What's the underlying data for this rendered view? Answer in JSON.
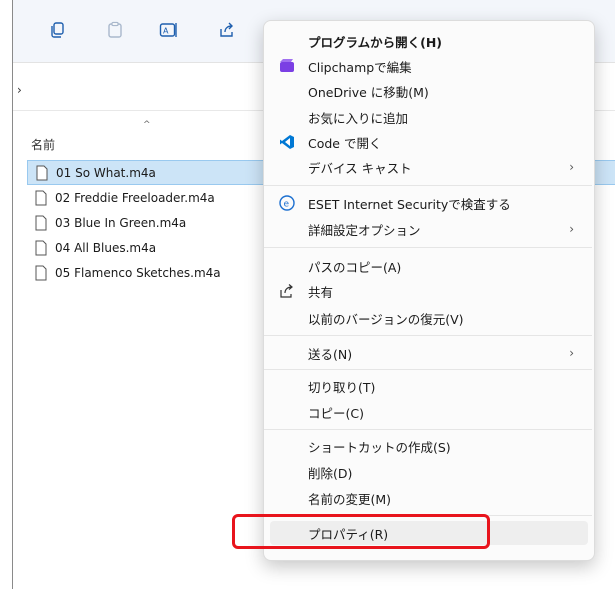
{
  "colors": {
    "selection": "#cce4f7",
    "highlight_box": "#e8141c",
    "clipchamp": "#7b3fe4",
    "vscode": "#0078d4",
    "eset": "#1b6fd0"
  },
  "toolbar": {
    "icons": [
      "copy-icon",
      "paste-icon",
      "rename-icon",
      "share-icon"
    ]
  },
  "addressbar": {
    "chevron": "›"
  },
  "column": {
    "name_header": "名前",
    "sort_caret": "^"
  },
  "files": [
    {
      "name": "01 So What.m4a"
    },
    {
      "name": "02 Freddie Freeloader.m4a"
    },
    {
      "name": "03 Blue In Green.m4a"
    },
    {
      "name": "04 All Blues.m4a"
    },
    {
      "name": "05 Flamenco Sketches.m4a"
    }
  ],
  "menu": {
    "open_with": "プログラムから開く(H)",
    "clipchamp": "Clipchampで編集",
    "onedrive": "OneDrive に移動(M)",
    "favorites": "お気に入りに追加",
    "code": "Code で開く",
    "cast": "デバイス キャスト",
    "eset": "ESET Internet Securityで検査する",
    "advanced": "詳細設定オプション",
    "copy_path": "パスのコピー(A)",
    "share": "共有",
    "restore": "以前のバージョンの復元(V)",
    "send_to": "送る(N)",
    "cut": "切り取り(T)",
    "copy": "コピー(C)",
    "shortcut": "ショートカットの作成(S)",
    "delete": "削除(D)",
    "rename": "名前の変更(M)",
    "properties": "プロパティ(R)",
    "arrow": "›"
  }
}
